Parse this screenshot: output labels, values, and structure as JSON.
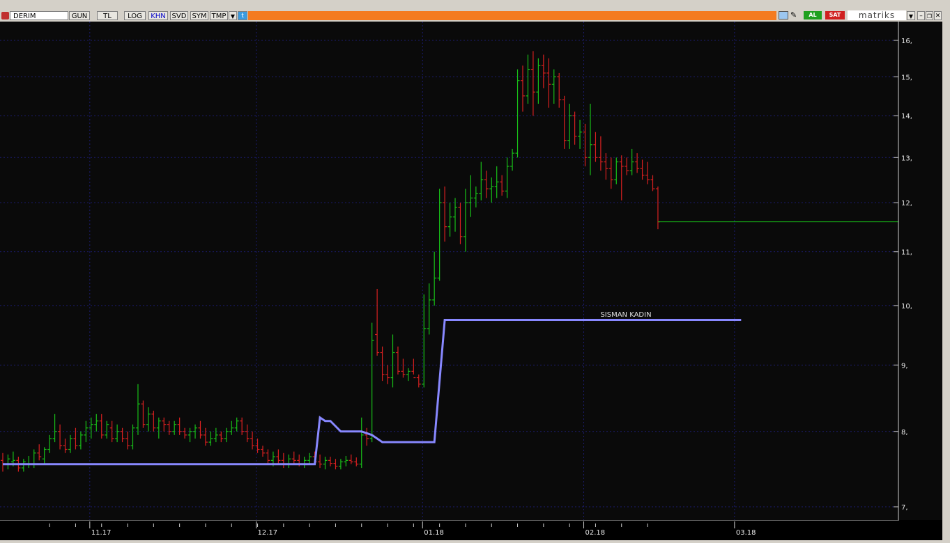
{
  "toolbar": {
    "symbol": "DERIM",
    "buttons": [
      "GUN",
      "TL",
      "LOG",
      "KHN",
      "SVD",
      "SYM",
      "TMP"
    ],
    "active_button": "KHN",
    "buy_label": "AL",
    "sell_label": "SAT",
    "brand": "matriks"
  },
  "colors": {
    "up": "#18c018",
    "down": "#d82020",
    "line": "#8888ff",
    "grid": "#1c1c70",
    "bg": "#0a0a0a"
  },
  "chart_data": {
    "type": "ohlc",
    "log_scale": true,
    "grid": true,
    "annotation": "SISMAN KADIN",
    "y_ticks": [
      "16,",
      "15,",
      "14,",
      "13,",
      "12,",
      "11,",
      "10,",
      "9,",
      "8,",
      "7,"
    ],
    "x_ticks": [
      "11.17",
      "12.17",
      "01.18",
      "02.18",
      "03.18"
    ],
    "ohlc": [
      [
        7.6,
        7.7,
        7.45,
        7.55
      ],
      [
        7.55,
        7.68,
        7.48,
        7.62
      ],
      [
        7.58,
        7.72,
        7.52,
        7.6
      ],
      [
        7.6,
        7.65,
        7.45,
        7.5
      ],
      [
        7.5,
        7.62,
        7.45,
        7.58
      ],
      [
        7.55,
        7.66,
        7.5,
        7.55
      ],
      [
        7.55,
        7.75,
        7.5,
        7.7
      ],
      [
        7.7,
        7.82,
        7.6,
        7.65
      ],
      [
        7.62,
        7.78,
        7.55,
        7.75
      ],
      [
        7.75,
        7.95,
        7.7,
        7.9
      ],
      [
        7.9,
        8.25,
        7.85,
        8.0
      ],
      [
        8.0,
        8.1,
        7.75,
        7.8
      ],
      [
        7.8,
        7.9,
        7.7,
        7.75
      ],
      [
        7.75,
        7.95,
        7.7,
        7.9
      ],
      [
        7.9,
        8.05,
        7.75,
        7.8
      ],
      [
        7.8,
        8.0,
        7.75,
        7.95
      ],
      [
        7.95,
        8.15,
        7.85,
        8.05
      ],
      [
        8.05,
        8.2,
        7.9,
        8.1
      ],
      [
        8.1,
        8.25,
        8.0,
        8.15
      ],
      [
        8.15,
        8.25,
        7.9,
        7.95
      ],
      [
        7.95,
        8.15,
        7.9,
        8.1
      ],
      [
        8.05,
        8.15,
        7.85,
        7.9
      ],
      [
        7.9,
        8.1,
        7.85,
        8.0
      ],
      [
        8.0,
        8.05,
        7.85,
        7.9
      ],
      [
        7.9,
        8.0,
        7.75,
        7.8
      ],
      [
        7.8,
        8.1,
        7.75,
        8.05
      ],
      [
        8.05,
        8.7,
        7.95,
        8.4
      ],
      [
        8.4,
        8.45,
        8.05,
        8.1
      ],
      [
        8.1,
        8.35,
        8.0,
        8.25
      ],
      [
        8.25,
        8.3,
        8.0,
        8.05
      ],
      [
        8.05,
        8.2,
        7.9,
        8.15
      ],
      [
        8.15,
        8.2,
        8.0,
        8.1
      ],
      [
        8.1,
        8.15,
        7.95,
        8.0
      ],
      [
        8.0,
        8.15,
        7.95,
        8.1
      ],
      [
        8.1,
        8.2,
        7.95,
        8.0
      ],
      [
        8.0,
        8.05,
        7.9,
        7.95
      ],
      [
        7.95,
        8.05,
        7.85,
        8.0
      ],
      [
        8.0,
        8.1,
        7.9,
        8.05
      ],
      [
        8.05,
        8.15,
        7.9,
        7.95
      ],
      [
        7.95,
        8.05,
        7.8,
        7.85
      ],
      [
        7.85,
        8.0,
        7.8,
        7.9
      ],
      [
        7.9,
        8.05,
        7.85,
        7.95
      ],
      [
        7.95,
        8.0,
        7.85,
        7.9
      ],
      [
        7.9,
        8.05,
        7.85,
        8.0
      ],
      [
        8.0,
        8.15,
        7.95,
        8.05
      ],
      [
        8.05,
        8.2,
        8.0,
        8.15
      ],
      [
        8.15,
        8.2,
        7.95,
        8.0
      ],
      [
        8.0,
        8.1,
        7.85,
        7.9
      ],
      [
        7.9,
        8.0,
        7.75,
        7.8
      ],
      [
        7.8,
        7.9,
        7.7,
        7.75
      ],
      [
        7.75,
        7.8,
        7.65,
        7.7
      ],
      [
        7.7,
        7.75,
        7.55,
        7.6
      ],
      [
        7.6,
        7.72,
        7.52,
        7.65
      ],
      [
        7.65,
        7.75,
        7.55,
        7.6
      ],
      [
        7.6,
        7.7,
        7.5,
        7.55
      ],
      [
        7.55,
        7.68,
        7.5,
        7.62
      ],
      [
        7.62,
        7.72,
        7.55,
        7.6
      ],
      [
        7.6,
        7.68,
        7.52,
        7.55
      ],
      [
        7.55,
        7.65,
        7.5,
        7.6
      ],
      [
        7.6,
        7.7,
        7.55,
        7.65
      ],
      [
        7.65,
        7.72,
        7.55,
        7.58
      ],
      [
        7.58,
        7.68,
        7.5,
        7.55
      ],
      [
        7.55,
        7.65,
        7.48,
        7.6
      ],
      [
        7.6,
        7.65,
        7.52,
        7.56
      ],
      [
        7.56,
        7.62,
        7.48,
        7.52
      ],
      [
        7.52,
        7.62,
        7.48,
        7.58
      ],
      [
        7.58,
        7.66,
        7.52,
        7.6
      ],
      [
        7.6,
        7.68,
        7.55,
        7.58
      ],
      [
        7.58,
        7.64,
        7.52,
        7.55
      ],
      [
        7.55,
        8.2,
        7.5,
        7.95
      ],
      [
        7.95,
        8.05,
        7.8,
        7.9
      ],
      [
        7.9,
        9.7,
        7.85,
        9.4
      ],
      [
        9.5,
        10.3,
        9.15,
        9.2
      ],
      [
        9.2,
        9.3,
        8.75,
        8.85
      ],
      [
        8.85,
        9.0,
        8.7,
        8.8
      ],
      [
        8.8,
        9.5,
        8.65,
        9.2
      ],
      [
        9.2,
        9.3,
        8.85,
        8.9
      ],
      [
        8.9,
        9.1,
        8.8,
        8.85
      ],
      [
        8.85,
        8.95,
        8.75,
        8.9
      ],
      [
        8.9,
        9.1,
        8.85,
        8.8
      ],
      [
        8.8,
        8.85,
        8.65,
        8.7
      ],
      [
        8.7,
        10.2,
        8.65,
        9.6
      ],
      [
        9.6,
        10.4,
        9.5,
        10.1
      ],
      [
        10.1,
        11.0,
        10.0,
        10.5
      ],
      [
        10.5,
        12.3,
        10.45,
        12.0
      ],
      [
        12.0,
        12.35,
        11.2,
        11.5
      ],
      [
        11.5,
        12.0,
        11.3,
        11.7
      ],
      [
        11.7,
        12.1,
        11.4,
        11.9
      ],
      [
        11.9,
        12.0,
        11.15,
        11.3
      ],
      [
        11.3,
        12.3,
        11.0,
        12.0
      ],
      [
        12.0,
        12.6,
        11.7,
        12.1
      ],
      [
        12.1,
        12.35,
        11.9,
        12.2
      ],
      [
        12.2,
        12.9,
        12.05,
        12.5
      ],
      [
        12.5,
        12.7,
        12.1,
        12.3
      ],
      [
        12.3,
        12.55,
        12.0,
        12.35
      ],
      [
        12.35,
        12.8,
        12.1,
        12.45
      ],
      [
        12.45,
        12.6,
        12.15,
        12.25
      ],
      [
        12.25,
        13.0,
        12.1,
        12.8
      ],
      [
        12.8,
        13.2,
        12.7,
        13.1
      ],
      [
        13.1,
        15.2,
        13.0,
        14.9
      ],
      [
        14.9,
        15.3,
        14.1,
        14.5
      ],
      [
        14.5,
        15.6,
        14.3,
        15.2
      ],
      [
        15.2,
        15.7,
        14.0,
        14.6
      ],
      [
        14.6,
        15.5,
        14.3,
        15.3
      ],
      [
        15.3,
        15.6,
        14.7,
        15.1
      ],
      [
        15.1,
        15.5,
        14.2,
        14.8
      ],
      [
        14.8,
        15.2,
        14.3,
        15.0
      ],
      [
        15.0,
        15.1,
        14.2,
        14.4
      ],
      [
        14.4,
        14.5,
        13.2,
        13.4
      ],
      [
        13.4,
        14.3,
        13.2,
        14.0
      ],
      [
        14.0,
        14.1,
        13.3,
        13.5
      ],
      [
        13.5,
        13.9,
        13.2,
        13.6
      ],
      [
        13.6,
        13.8,
        12.8,
        13.0
      ],
      [
        13.0,
        14.3,
        12.6,
        13.3
      ],
      [
        13.3,
        13.6,
        12.9,
        13.0
      ],
      [
        13.0,
        13.5,
        12.7,
        12.9
      ],
      [
        12.9,
        13.1,
        12.5,
        12.75
      ],
      [
        12.75,
        13.0,
        12.3,
        12.5
      ],
      [
        12.5,
        13.0,
        12.4,
        12.9
      ],
      [
        12.9,
        13.05,
        12.05,
        12.8
      ],
      [
        12.8,
        13.0,
        12.6,
        12.7
      ],
      [
        12.7,
        13.2,
        12.6,
        12.9
      ],
      [
        12.9,
        13.1,
        12.65,
        12.75
      ],
      [
        12.75,
        12.95,
        12.5,
        12.6
      ],
      [
        12.6,
        12.9,
        12.4,
        12.5
      ],
      [
        12.5,
        12.6,
        12.25,
        12.3
      ],
      [
        12.3,
        12.35,
        11.45,
        11.6
      ]
    ],
    "indicator_line": {
      "name": "SISMAN KADIN",
      "points": [
        [
          0,
          7.55
        ],
        [
          60,
          7.55
        ],
        [
          61,
          8.2
        ],
        [
          62,
          8.15
        ],
        [
          63,
          8.15
        ],
        [
          65,
          8.0
        ],
        [
          69,
          8.0
        ],
        [
          71,
          7.95
        ],
        [
          73,
          7.85
        ],
        [
          83,
          7.85
        ],
        [
          85,
          9.75
        ],
        [
          142,
          9.75
        ]
      ]
    },
    "last_price": 11.6
  }
}
